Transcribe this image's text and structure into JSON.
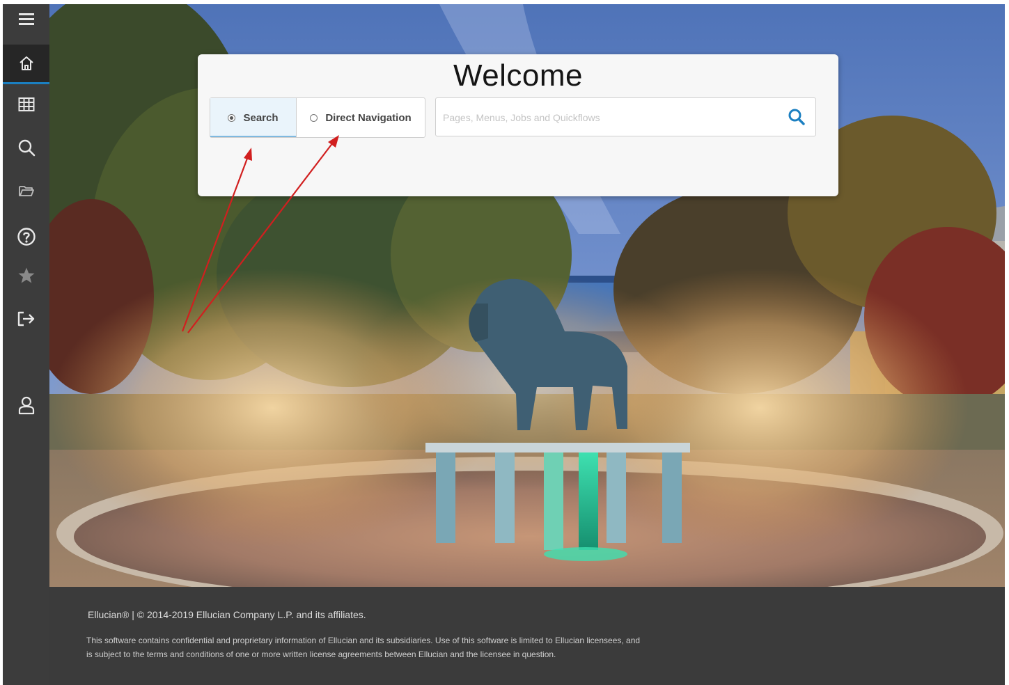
{
  "colors": {
    "sidebar_bg": "#3c3c3c",
    "sidebar_active_bg": "#262626",
    "accent": "#1b7fc1",
    "footer_bg": "#3b3b3b",
    "annotation_arrow": "#d11f1f"
  },
  "sidebar": {
    "items": [
      {
        "icon": "hamburger-menu-icon"
      },
      {
        "icon": "home-icon",
        "active": true
      },
      {
        "icon": "grid-icon"
      },
      {
        "icon": "search-icon"
      },
      {
        "icon": "folder-icon"
      },
      {
        "icon": "help-icon"
      },
      {
        "icon": "star-icon"
      },
      {
        "icon": "sign-out-icon"
      },
      {
        "icon": "user-icon"
      }
    ]
  },
  "welcome": {
    "title": "Welcome",
    "modes": [
      {
        "label": "Search",
        "selected": true
      },
      {
        "label": "Direct Navigation",
        "selected": false
      }
    ],
    "search": {
      "placeholder": "Pages, Menus, Jobs and Quickflows",
      "value": "",
      "icon": "search-icon"
    }
  },
  "background": {
    "icon": "campus-fountain-lion-photo"
  },
  "footer": {
    "copyright": "Ellucian® | © 2014-2019 Ellucian Company L.P. and its affiliates.",
    "disclaimer": "This software contains confidential and proprietary information of Ellucian and its subsidiaries. Use of this software is limited to Ellucian licensees, and is subject to the terms and conditions of one or more written license agreements between Ellucian and the licensee in question."
  }
}
